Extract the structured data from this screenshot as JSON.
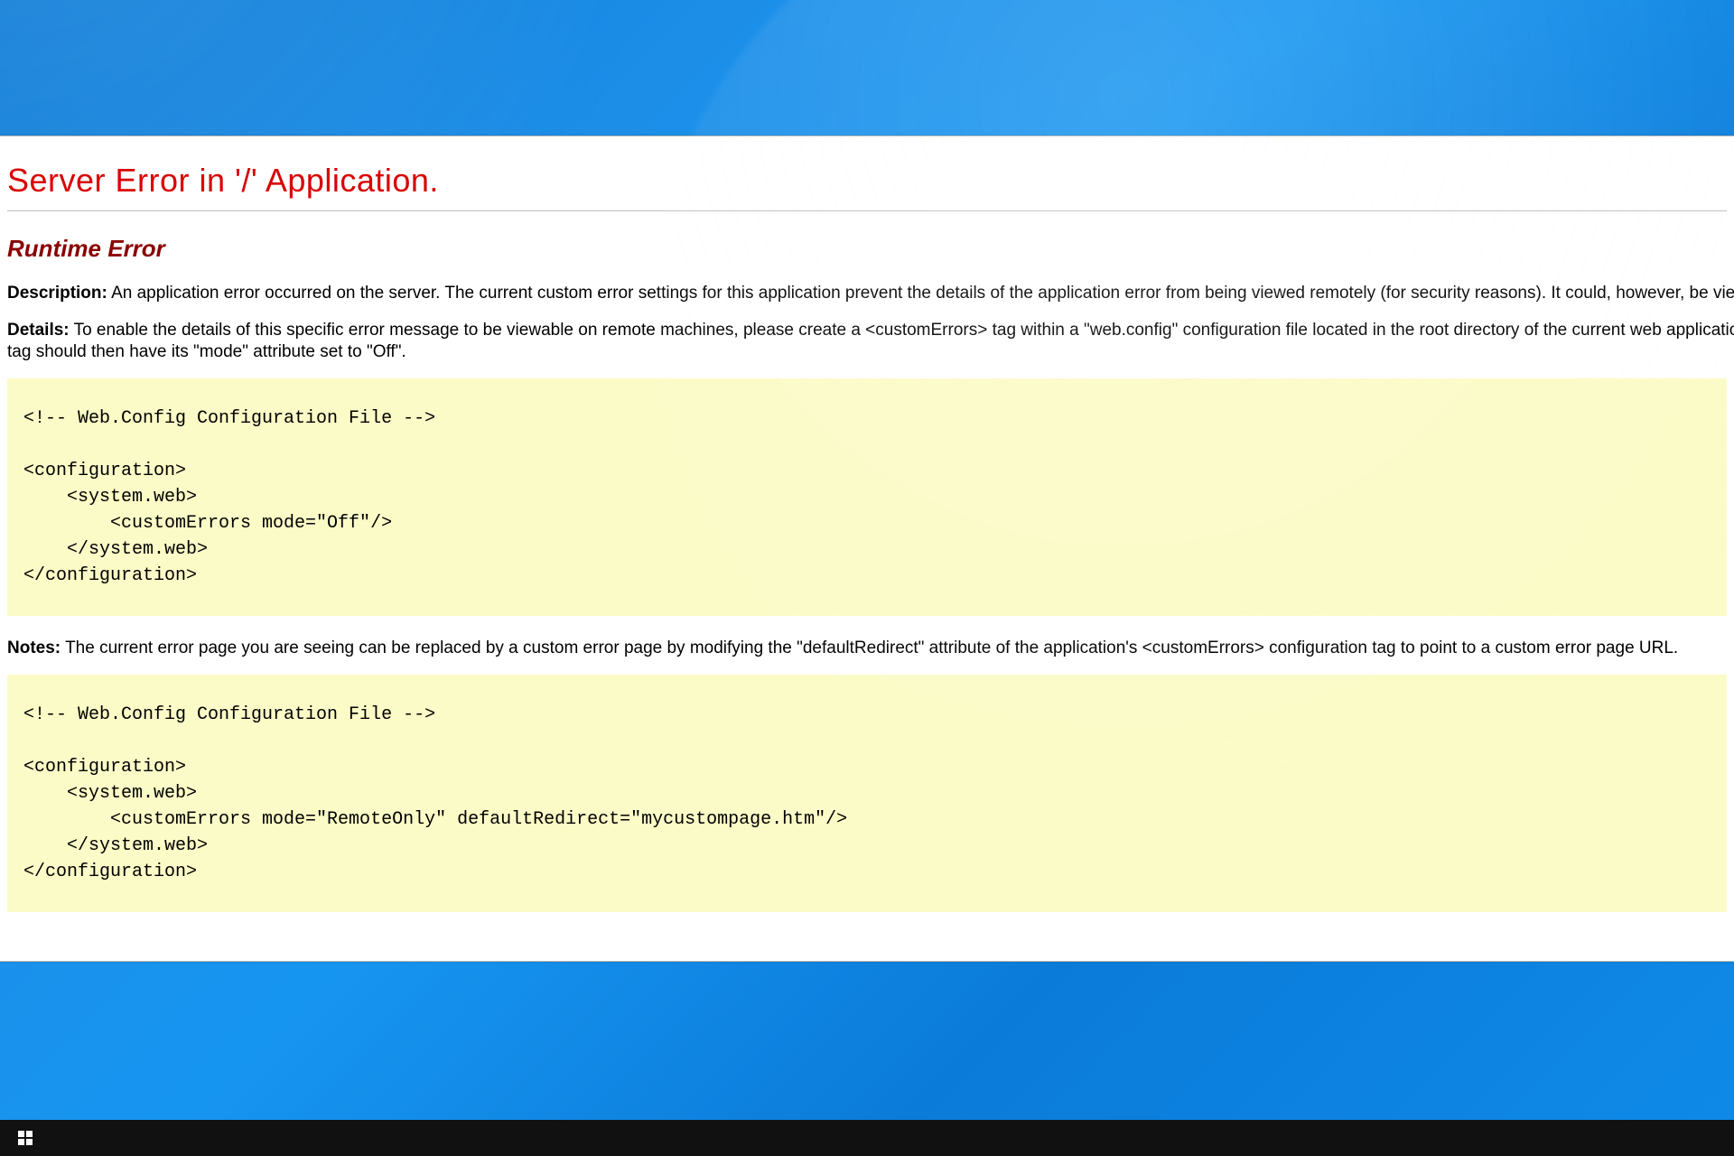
{
  "error": {
    "title": "Server Error in '/' Application.",
    "subtitle": "Runtime Error",
    "description_label": "Description:",
    "description_text": "An application error occurred on the server. The current custom error settings for this application prevent the details of the application error from being viewed remotely (for security reasons). It could, however, be viewed by browsers",
    "details_label": "Details:",
    "details_text": "To enable the details of this specific error message to be viewable on remote machines, please create a <customErrors> tag within a \"web.config\" configuration file located in the root directory of the current web application. This <customErrors> tag should then have its \"mode\" attribute set to \"Off\".",
    "code1": "<!-- Web.Config Configuration File -->\n\n<configuration>\n    <system.web>\n        <customErrors mode=\"Off\"/>\n    </system.web>\n</configuration>",
    "notes_label": "Notes:",
    "notes_text": "The current error page you are seeing can be replaced by a custom error page by modifying the \"defaultRedirect\" attribute of the application's <customErrors> configuration tag to point to a custom error page URL.",
    "code2": "<!-- Web.Config Configuration File -->\n\n<configuration>\n    <system.web>\n        <customErrors mode=\"RemoteOnly\" defaultRedirect=\"mycustompage.htm\"/>\n    </system.web>\n</configuration>"
  }
}
